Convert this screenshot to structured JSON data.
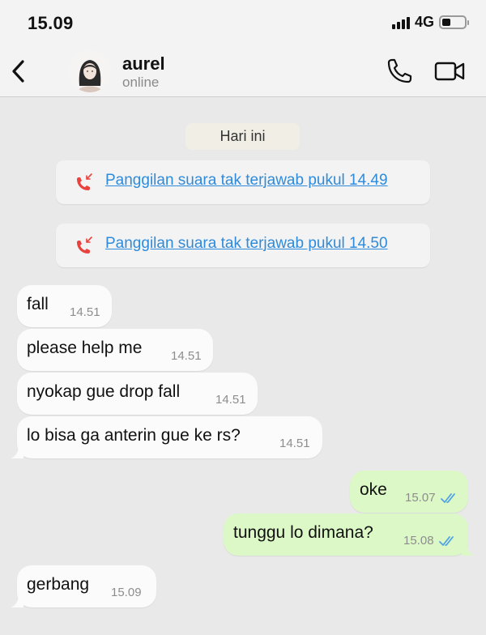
{
  "status_bar": {
    "time": "15.09",
    "network": "4G"
  },
  "header": {
    "contact_name": "aurel",
    "contact_status": "online"
  },
  "date_chip": "Hari ini",
  "missed_calls": [
    {
      "text": "Panggilan suara tak terjawab pukul 14.49"
    },
    {
      "text": "Panggilan suara tak terjawab pukul 14.50"
    }
  ],
  "messages": [
    {
      "direction": "in",
      "text": "fall",
      "time": "14.51"
    },
    {
      "direction": "in",
      "text": "please help me",
      "time": "14.51"
    },
    {
      "direction": "in",
      "text": "nyokap gue drop fall",
      "time": "14.51"
    },
    {
      "direction": "in",
      "text": "lo bisa ga anterin gue ke rs?",
      "time": "14.51"
    },
    {
      "direction": "out",
      "text": "oke",
      "time": "15.07",
      "read": true
    },
    {
      "direction": "out",
      "text": "tunggu lo dimana?",
      "time": "15.08",
      "read": true
    },
    {
      "direction": "in",
      "text": "gerbang",
      "time": "15.09"
    }
  ],
  "colors": {
    "outgoing_bubble": "#dcf8c6",
    "incoming_bubble": "#fbfbfb",
    "link": "#2e8bdb",
    "missed_call": "#e8433e",
    "read_ticks": "#4fa3e6"
  }
}
